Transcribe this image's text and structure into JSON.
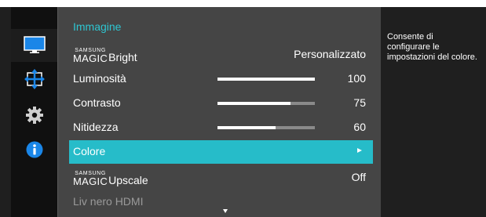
{
  "menu": {
    "title": "Immagine",
    "items": [
      {
        "magic": true,
        "brand": "SAMSUNG",
        "magic_word": "MAGIC",
        "label": "Bright",
        "value": "Personalizzato"
      },
      {
        "label": "Luminosità",
        "value": "100",
        "level": 1.0
      },
      {
        "label": "Contrasto",
        "value": "75",
        "level": 0.75
      },
      {
        "label": "Nitidezza",
        "value": "60",
        "level": 0.6
      },
      {
        "label": "Colore",
        "selected": true
      },
      {
        "magic": true,
        "brand": "SAMSUNG",
        "magic_word": "MAGIC",
        "label": "Upscale",
        "value": "Off"
      },
      {
        "label": "Liv nero HDMI",
        "disabled": true
      }
    ]
  },
  "description": "Consente di configurare le impostazioni del colore.",
  "nav_icons": [
    "monitor-icon",
    "resize-arrows-icon",
    "gear-icon",
    "info-icon"
  ],
  "colors": {
    "accent": "#26bcc9",
    "title": "#2ec6d2",
    "info": "#1a86e8"
  }
}
